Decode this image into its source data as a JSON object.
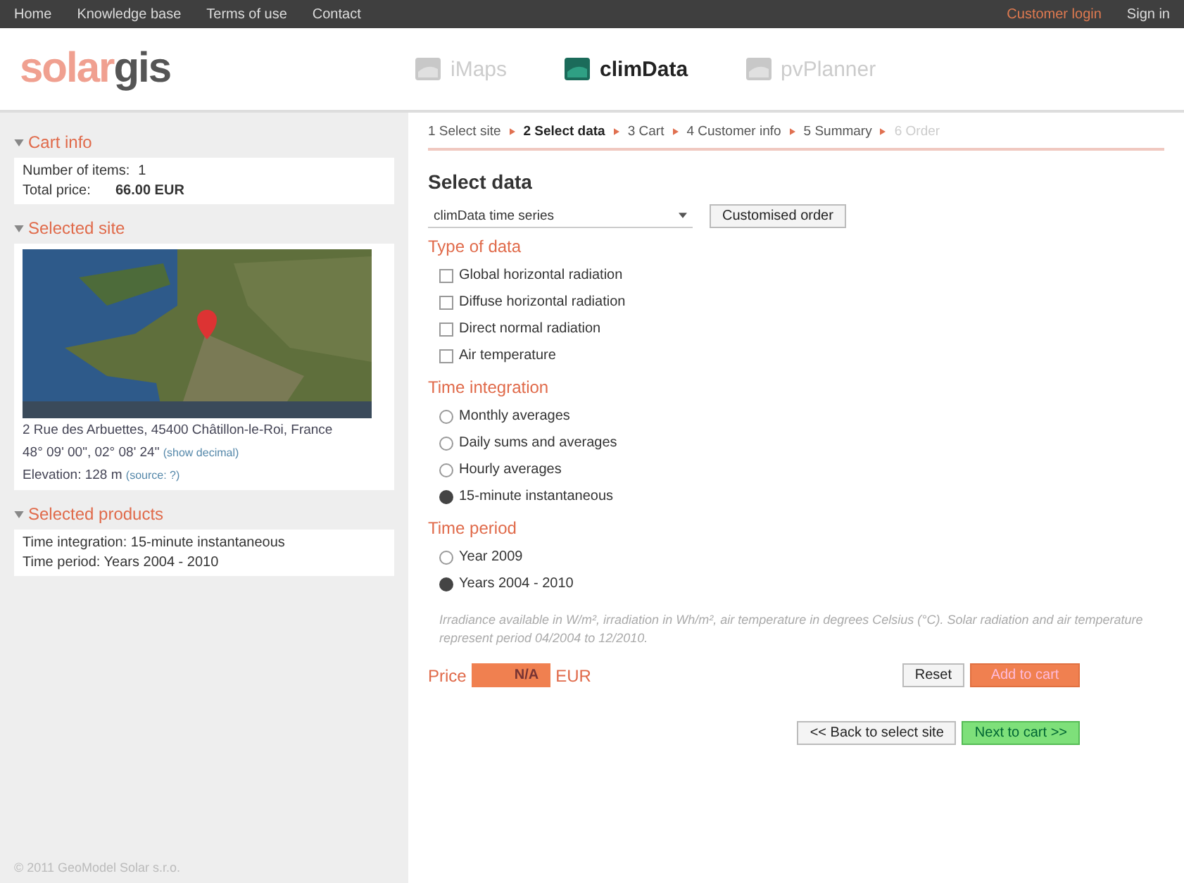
{
  "top_nav": {
    "links": [
      "Home",
      "Knowledge base",
      "Terms of use",
      "Contact"
    ],
    "account_link": "Customer login",
    "sign_in": "Sign in"
  },
  "header": {
    "logo": {
      "part_1": "solar",
      "part_2": "gis"
    },
    "apps": [
      {
        "label": "iMaps",
        "selected": false
      },
      {
        "label": "climData",
        "selected": true
      },
      {
        "label": "pvPlanner",
        "selected": false
      }
    ]
  },
  "sidebar": {
    "cart": {
      "title": "Cart info",
      "items_label": "Number of items:",
      "items_value": "1",
      "price_label": "Total price:",
      "price_value": "66.00 EUR"
    },
    "site": {
      "title": "Selected site",
      "address": "2 Rue des Arbuettes, 45400 Châtillon-le-Roi, France",
      "coordinates": "48° 09' 00\", 02° 08' 24\"",
      "coordinates_link": "(show decimal)",
      "elevation": "Elevation: 128 m",
      "elevation_link": "(source: ?)"
    },
    "products": {
      "title": "Selected products",
      "lines": [
        "Time integration: 15-minute instantaneous",
        "Time period: Years 2004 - 2010"
      ]
    },
    "footer": "© 2011 GeoModel Solar s.r.o."
  },
  "steps": [
    {
      "label": "1 Select site",
      "selected": false,
      "disabled": false
    },
    {
      "label": "2 Select data",
      "selected": true,
      "disabled": false
    },
    {
      "label": "3 Cart",
      "selected": false,
      "disabled": false
    },
    {
      "label": "4 Customer info",
      "selected": false,
      "disabled": false
    },
    {
      "label": "5 Summary",
      "selected": false,
      "disabled": false
    },
    {
      "label": "6 Order",
      "selected": false,
      "disabled": true
    }
  ],
  "main": {
    "title": "Select data",
    "product_select": {
      "value": "climData time series"
    },
    "custom_button": "Customised order",
    "data_types": {
      "title": "Type of data",
      "options": [
        {
          "label": "Global horizontal radiation",
          "checked": false
        },
        {
          "label": "Diffuse horizontal radiation",
          "checked": false
        },
        {
          "label": "Direct normal radiation",
          "checked": false
        },
        {
          "label": "Air temperature",
          "checked": false
        }
      ]
    },
    "integration": {
      "title": "Time integration",
      "options": [
        {
          "label": "Monthly averages",
          "selected": false
        },
        {
          "label": "Daily sums and averages",
          "selected": false
        },
        {
          "label": "Hourly averages",
          "selected": false
        },
        {
          "label": "15-minute instantaneous",
          "selected": true
        }
      ]
    },
    "period": {
      "title": "Time period",
      "options": [
        {
          "label": "Year 2009",
          "selected": false
        },
        {
          "label": "Years 2004 - 2010",
          "selected": true
        }
      ]
    },
    "note": "Irradiance available in W/m², irradiation in Wh/m², air temperature in degrees Celsius (°C). Solar radiation and air temperature represent period 04/2004 to 12/2010.",
    "price_label": "Price",
    "price_value": "N/A",
    "price_unit": "EUR",
    "reset_button": "Reset",
    "add_button": "Add to cart",
    "back_button": "<< Back to select site",
    "next_button": "Next to cart >>"
  }
}
